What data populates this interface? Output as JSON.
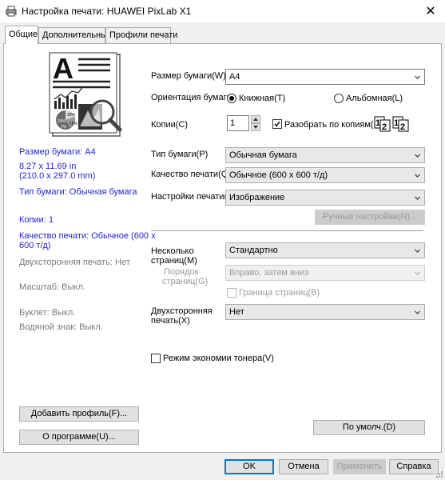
{
  "window": {
    "title": "Настройка печати: HUAWEI PixLab X1",
    "close_icon": "close-icon",
    "printer_icon": "printer-icon"
  },
  "tabs": [
    {
      "label": "Общие",
      "active": true
    },
    {
      "label": "Дополнительные",
      "active": false
    },
    {
      "label": "Профили печати",
      "active": false
    }
  ],
  "summary": {
    "paper_size": "Размер бумаги: A4",
    "dims_in": "8.27 x 11.69 in",
    "dims_mm": "(210.0 x 297.0 mm)",
    "media_type": "Тип бумаги: Обычная бумага",
    "copies": "Копии: 1",
    "quality_line1": "Качество печати: Обычное (600 x",
    "quality_line2": "600 т/д)",
    "duplex": "Двухсторонняя печать: Нет",
    "scale": "Масштаб: Выкл.",
    "booklet": "Буклет: Выкл.",
    "watermark": "Водяной знак: Выкл."
  },
  "form": {
    "paper_size_label": "Размер бумаги(W)",
    "paper_size_value": "A4",
    "orientation_label": "Ориентация бумаги",
    "portrait_label": "Книжная(T)",
    "landscape_label": "Альбомная(L)",
    "orientation_selected": "portrait",
    "copies_label": "Копии(C)",
    "copies_value": "1",
    "collate_label": "Разобрать по копиям(E)",
    "collate_checked": true,
    "media_type_label": "Тип бумаги(P)",
    "media_type_value": "Обычная бумага",
    "quality_label": "Качество печати(Q)",
    "quality_value": "Обычное (600 x 600 т/д)",
    "print_settings_label": "Настройки печати(I)",
    "print_settings_value": "Изображение",
    "manual_settings_button": "Ручные настройки(N)...",
    "multipage_label_1": "Несколько",
    "multipage_label_2": "страниц(M)",
    "multipage_value": "Стандартно",
    "page_order_label_1": "Порядок",
    "page_order_label_2": "страниц(G)",
    "page_order_value": "Вправо, затем вниз",
    "border_label": "Граница страниц(B)",
    "border_checked": false,
    "duplex_label_1": "Двухсторонняя",
    "duplex_label_2": "печать(X)",
    "duplex_value": "Нет",
    "toner_save_label": "Режим экономии тонера(V)",
    "toner_save_checked": false
  },
  "buttons": {
    "add_profile": "Добавить профиль(F)...",
    "about": "О программе(U)...",
    "default": "По умолч.(D)",
    "ok": "OK",
    "cancel": "Отмена",
    "apply": "Применить",
    "help": "Справка"
  },
  "preview": {
    "big_letter": "A",
    "chart_labels": [
      "30%",
      "24%",
      "16%",
      "7%"
    ]
  },
  "colors": {
    "summary_blue": "#1f1fd6",
    "disabled_text": "#9a9a9a",
    "default_button_border": "#0078d7"
  }
}
